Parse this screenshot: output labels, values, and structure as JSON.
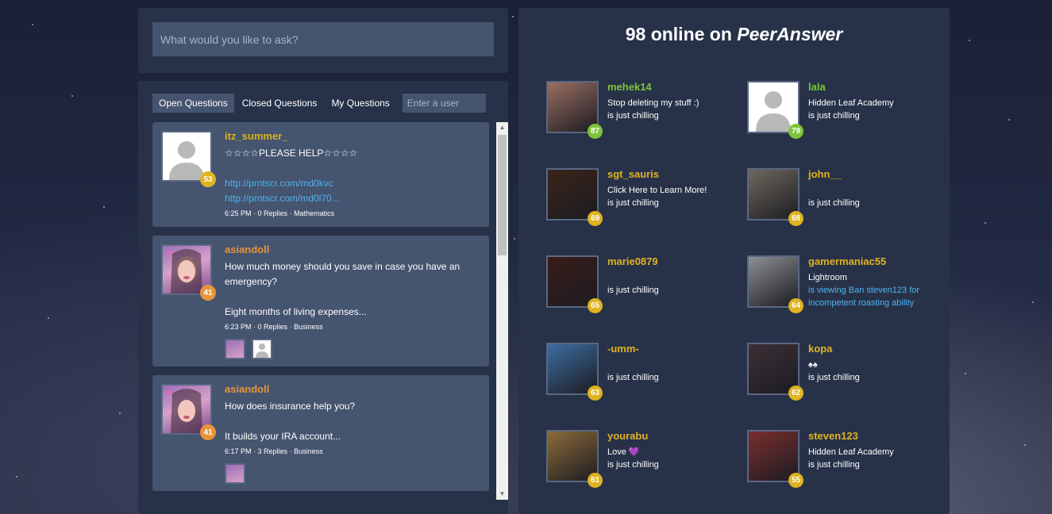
{
  "search": {
    "placeholder": "What would you like to ask?"
  },
  "tabs": [
    "Open Questions",
    "Closed Questions",
    "My Questions"
  ],
  "user_filter": {
    "placeholder": "Enter a user"
  },
  "questions": [
    {
      "user": "itz_summer_",
      "user_color": "#d6b21f",
      "level": "53",
      "level_color": "#e0b320",
      "title": "☆☆☆☆PLEASE HELP☆☆☆☆",
      "links": [
        "http://prntscr.com/md0kvc",
        "http://prntscr.com/md0l70..."
      ],
      "time": "6:25 PM",
      "replies": "0 Replies",
      "subject": "Mathematics",
      "avatar": "default"
    },
    {
      "user": "asiandoll",
      "user_color": "#e8943a",
      "level": "41",
      "level_color": "#e8943a",
      "title": "How much money should you save in case you have an emergency?",
      "excerpt": "Eight months of living expenses...",
      "time": "6:23 PM",
      "replies": "0 Replies",
      "subject": "Business",
      "avatar": "photo"
    },
    {
      "user": "asiandoll",
      "user_color": "#e8943a",
      "level": "41",
      "level_color": "#e8943a",
      "title": "How does insurance help you?",
      "excerpt": "It builds your IRA account...",
      "time": "6:17 PM",
      "replies": "3 Replies",
      "subject": "Business",
      "avatar": "photo"
    }
  ],
  "online": {
    "count": "98 online on",
    "brand": "PeerAnswer",
    "users": [
      {
        "name": "mehek14",
        "color": "#7ec43a",
        "level": "87",
        "level_color": "#7ec43a",
        "line1": "Stop deleting my stuff :)",
        "line2": "is just chilling",
        "avatar_color": "#9a6f63"
      },
      {
        "name": "lala",
        "color": "#7ec43a",
        "level": "79",
        "level_color": "#7ec43a",
        "line1": "Hidden Leaf Academy",
        "line2": "is just chilling",
        "avatar_color": "default"
      },
      {
        "name": "sgt_sauris",
        "color": "#e0b320",
        "level": "69",
        "level_color": "#e0b320",
        "line1": "Click Here to Learn More!",
        "line2": "is just chilling",
        "avatar_color": "#3a2418"
      },
      {
        "name": "john__",
        "color": "#e0b320",
        "level": "68",
        "level_color": "#e0b320",
        "line1": "",
        "line2": "is just chilling",
        "avatar_color": "#6f685e"
      },
      {
        "name": "marie0879",
        "color": "#e0b320",
        "level": "65",
        "level_color": "#e0b320",
        "line1": "",
        "line2": "is just chilling",
        "avatar_color": "#3a1c18"
      },
      {
        "name": "gamermaniac55",
        "color": "#e0b320",
        "level": "64",
        "level_color": "#e0b320",
        "line1": "Lightroom",
        "line2": "is viewing Ban steven123 for incompetent roasting ability",
        "line2_link": true,
        "avatar_color": "#8c8f93"
      },
      {
        "name": "-umm-",
        "color": "#e0b320",
        "level": "63",
        "level_color": "#e0b320",
        "line1": "",
        "line2": "is just chilling",
        "avatar_color": "#3d6da0"
      },
      {
        "name": "kopa",
        "color": "#e0b320",
        "level": "62",
        "level_color": "#e0b320",
        "line1": "♠♠",
        "line2": "is just chilling",
        "avatar_color": "#3b3035"
      },
      {
        "name": "yourabu",
        "color": "#e0b320",
        "level": "61",
        "level_color": "#e0b320",
        "line1": "Love 💜",
        "line2": "is just chilling",
        "avatar_color": "#8b6b3a"
      },
      {
        "name": "steven123",
        "color": "#e0b320",
        "level": "55",
        "level_color": "#e0b320",
        "line1": "Hidden Leaf Academy",
        "line2": "is just chilling",
        "avatar_color": "#7a2e2e"
      }
    ]
  }
}
